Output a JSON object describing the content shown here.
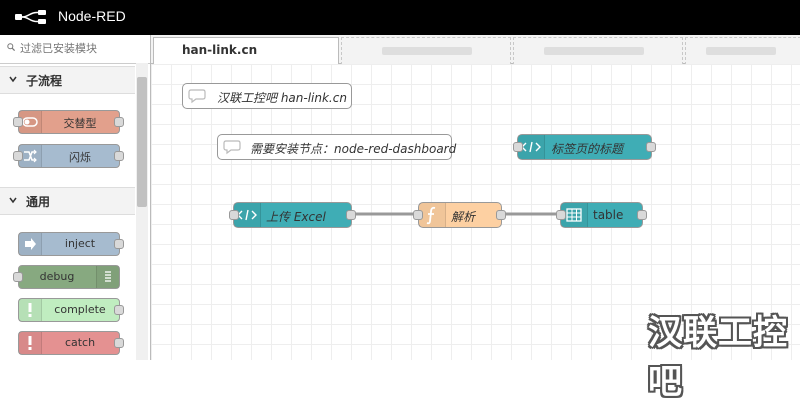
{
  "app": {
    "title": "Node-RED",
    "logo_icon": "node-red-logo-icon"
  },
  "palette": {
    "search_placeholder": "过滤已安装模块",
    "categories": [
      {
        "label": "子流程",
        "nodes": [
          {
            "label": "交替型",
            "color": "#e2a08c",
            "icon": "toggle-icon"
          },
          {
            "label": "闪烁",
            "color": "#a6bbcf",
            "icon": "shuffle-icon"
          }
        ]
      },
      {
        "label": "通用",
        "nodes": [
          {
            "label": "inject",
            "color": "#a6bbcf",
            "icon": "arrow-right-icon"
          },
          {
            "label": "debug",
            "color": "#87a980",
            "icon": "list-icon"
          },
          {
            "label": "complete",
            "color": "#c0edc0",
            "icon": "exclamation-icon"
          },
          {
            "label": "catch",
            "color": "#e49191",
            "icon": "exclamation-icon"
          }
        ]
      }
    ]
  },
  "tabs": {
    "active": "han-link.cn"
  },
  "workspace": {
    "comments": [
      "汉联工控吧 han-link.cn",
      "需要安装节点：node-red-dashboard"
    ],
    "nodes": [
      {
        "label": "标签页的标题",
        "color": "#3fadb5",
        "icon": "code-icon"
      },
      {
        "label": "上传 Excel",
        "color": "#3fadb5",
        "icon": "code-icon"
      },
      {
        "label": "解析",
        "color": "#fdd0a2",
        "icon": "function-icon"
      },
      {
        "label": "table",
        "color": "#3fadb5",
        "icon": "table-icon"
      }
    ]
  },
  "watermark": "汉联工控吧"
}
